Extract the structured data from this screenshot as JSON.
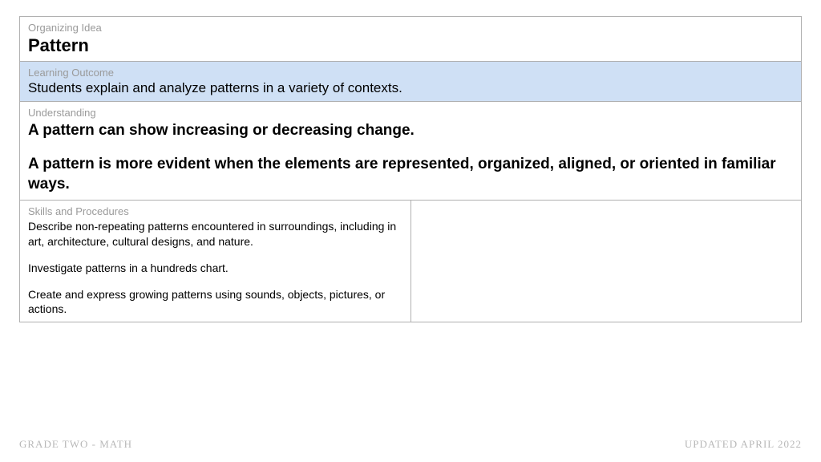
{
  "organizing_idea": {
    "label": "Organizing Idea",
    "value": "Pattern"
  },
  "learning_outcome": {
    "label": "Learning Outcome",
    "value": "Students explain and analyze patterns in a variety of contexts."
  },
  "understanding": {
    "label": "Understanding",
    "paragraphs": [
      "A pattern can show increasing or decreasing change.",
      "A pattern is more evident when the elements are represented, organized, aligned, or oriented in familiar ways."
    ]
  },
  "skills": {
    "label": "Skills and Procedures",
    "paragraphs": [
      "Describe non-repeating patterns encountered in surroundings, including in art, architecture, cultural designs, and nature.",
      "Investigate patterns in a hundreds chart.",
      "Create and express growing patterns using sounds, objects, pictures, or actions."
    ]
  },
  "footer": {
    "left": "GRADE TWO - MATH",
    "right": "UPDATED APRIL 2022"
  }
}
